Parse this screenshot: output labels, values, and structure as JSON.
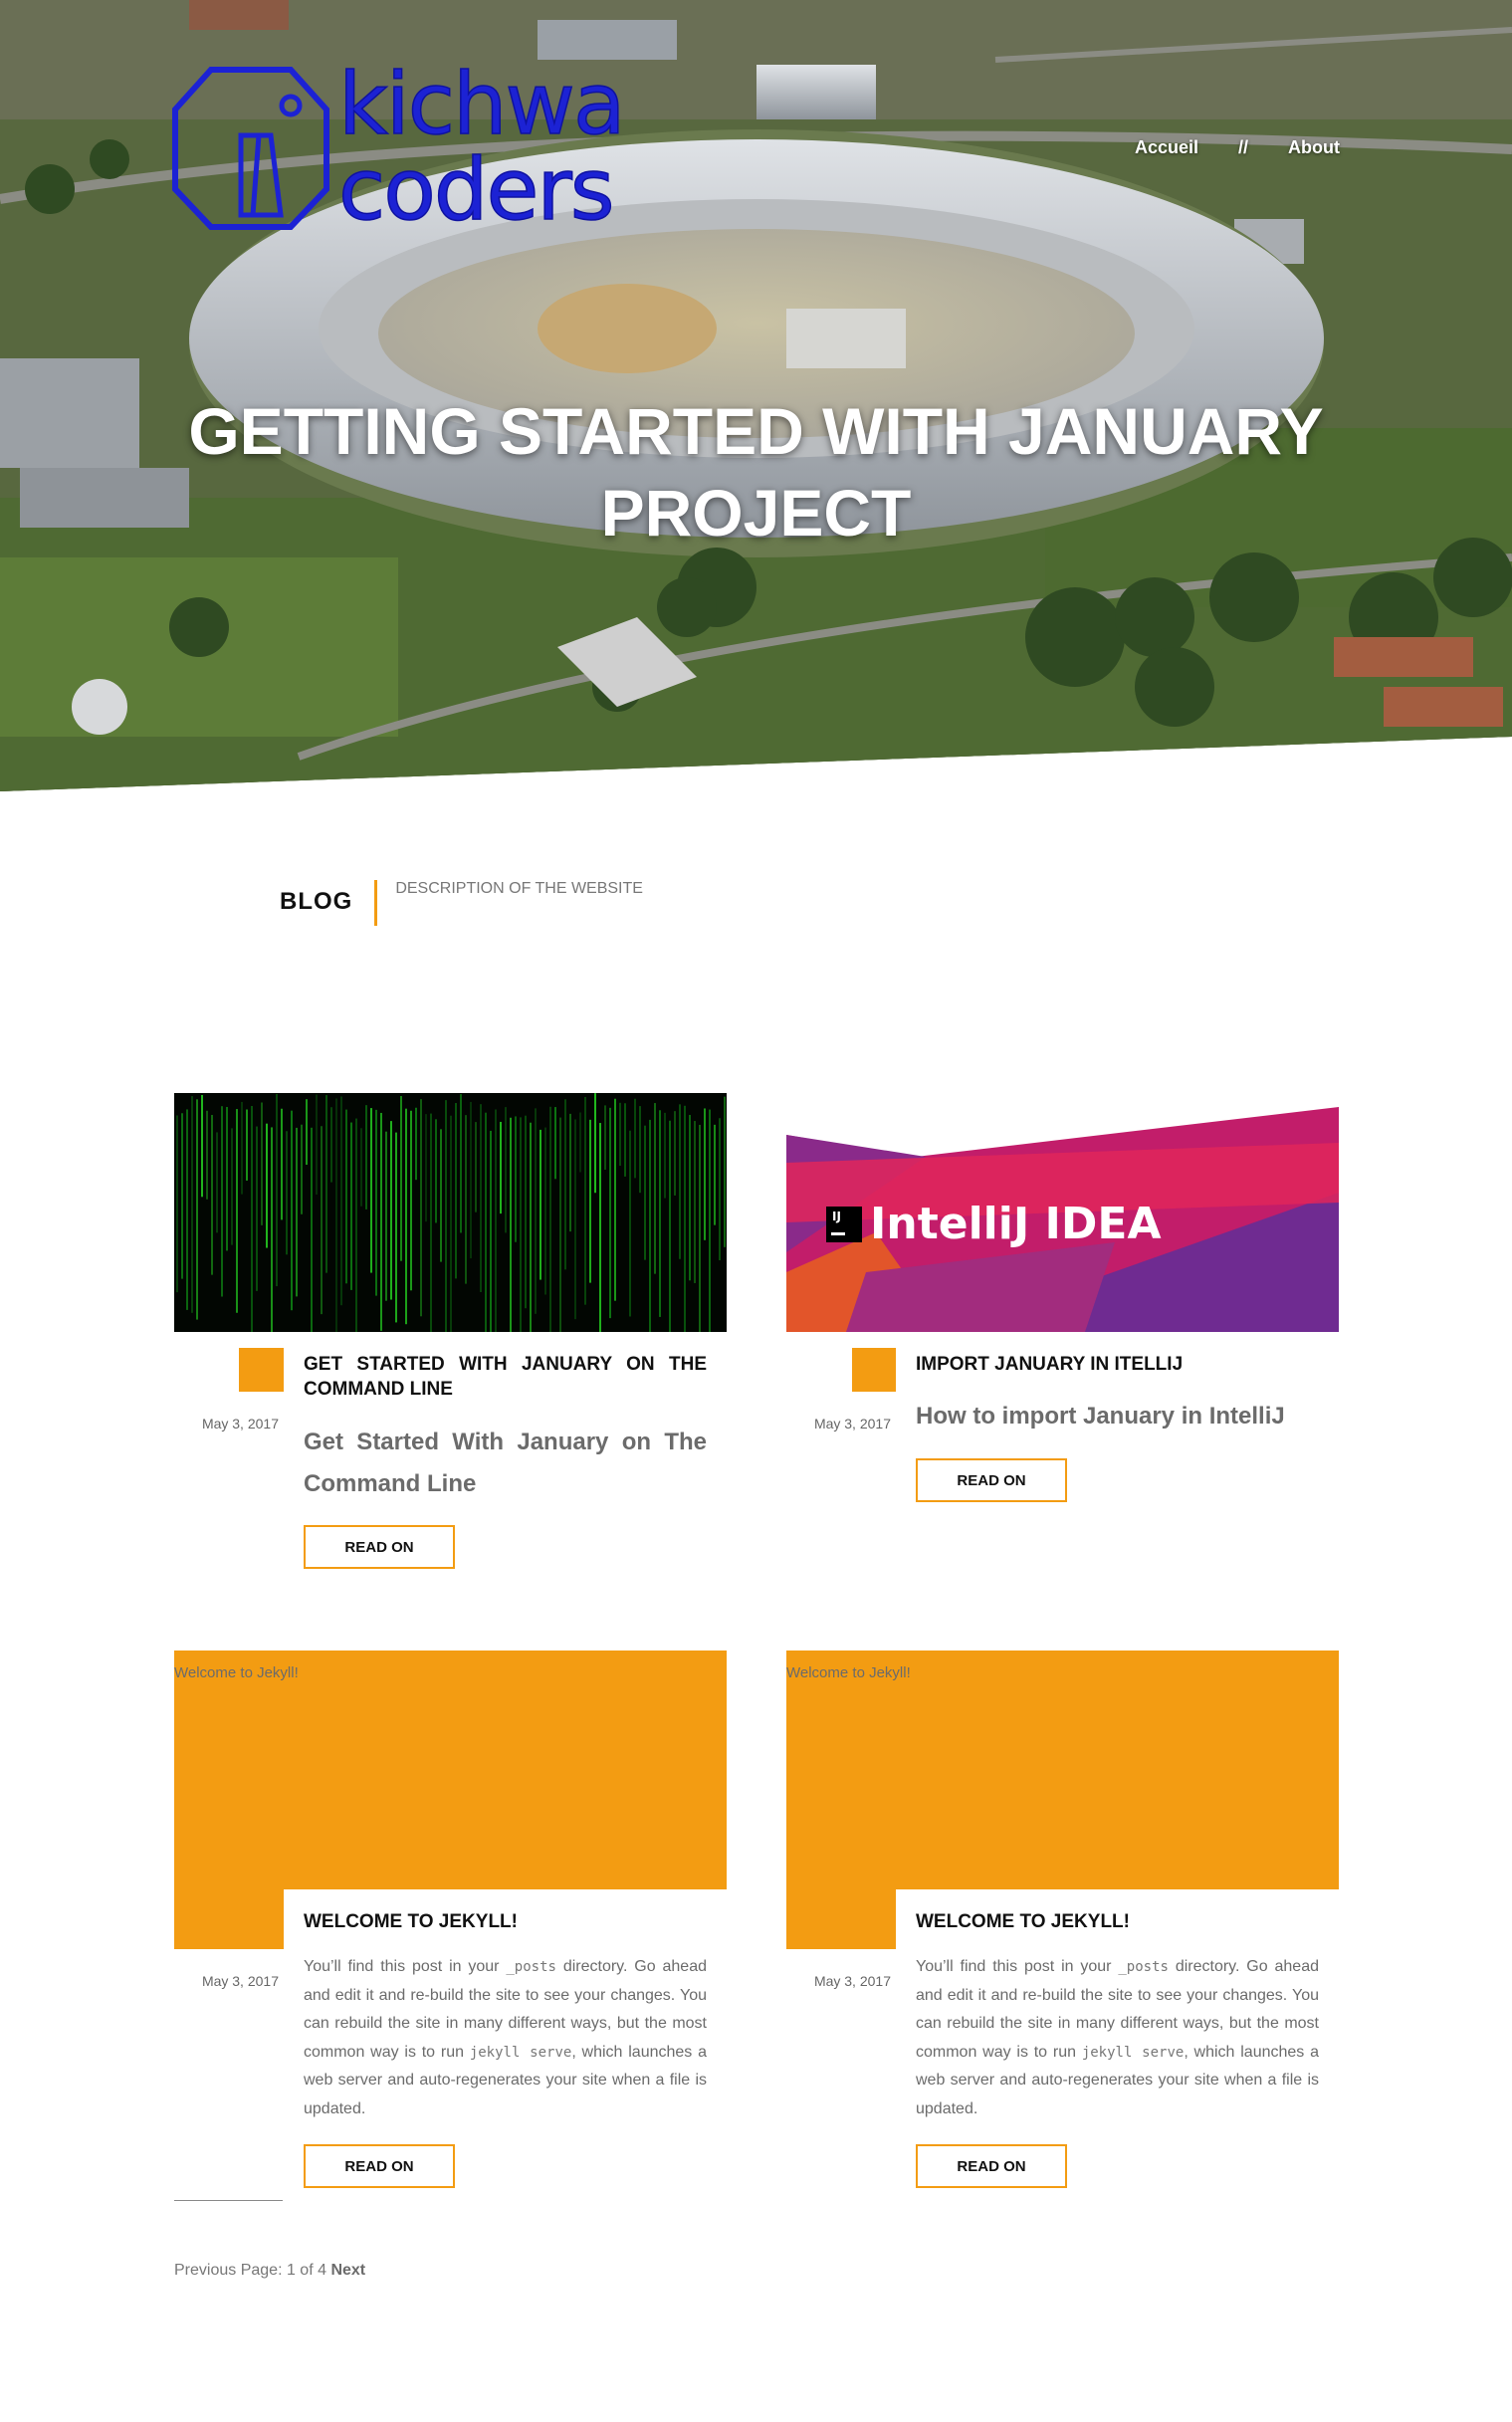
{
  "hero": {
    "logo_line1": "kichwa",
    "logo_line2": "coders",
    "title": "GETTING STARTED WITH JANUARY PROJECT"
  },
  "nav": {
    "items": [
      "Accueil",
      "About"
    ],
    "separator": "//"
  },
  "blog": {
    "label": "BLOG",
    "description": "DESCRIPTION OF THE WEBSITE"
  },
  "posts": [
    {
      "title": "GET STARTED WITH JANUARY ON THE COMMAND LINE",
      "date": "May 3, 2017",
      "excerpt": "Get Started With January on The Command Line",
      "button": "READ ON"
    },
    {
      "title": "IMPORT JANUARY IN ITELLIJ",
      "date": "May 3, 2017",
      "image_text": "IntelliJ IDEA",
      "image_badge": "IJ",
      "excerpt": "How to import January in IntelliJ",
      "button": "READ ON"
    },
    {
      "title": "WELCOME TO JEKYLL!",
      "date": "May 3, 2017",
      "image_alt": "Welcome to Jekyll!",
      "excerpt_a": "You’ll find this post in your ",
      "excerpt_code1": "_posts",
      "excerpt_b": " directory. Go ahead and edit it and re-build the site to see your changes. You can rebuild the site in many different ways, but the most common way is to run ",
      "excerpt_code2": "jekyll serve",
      "excerpt_c": ", which launches a web server and auto-regenerates your site when a file is updated.",
      "button": "READ ON"
    },
    {
      "title": "WELCOME TO JEKYLL!",
      "date": "May 3, 2017",
      "image_alt": "Welcome to Jekyll!",
      "excerpt_a": "You’ll find this post in your ",
      "excerpt_code1": "_posts",
      "excerpt_b": " directory. Go ahead and edit it and re-build the site to see your changes. You can rebuild the site in many different ways, but the most common way is to run ",
      "excerpt_code2": "jekyll serve",
      "excerpt_c": ", which launches a web server and auto-regenerates your site when a file is updated.",
      "button": "READ ON"
    }
  ],
  "pagination": {
    "previous": "Previous",
    "page_label": "Page: 1 of 4",
    "next": "Next"
  },
  "colors": {
    "accent": "#f39c12",
    "logo_blue": "#1c22d4"
  }
}
